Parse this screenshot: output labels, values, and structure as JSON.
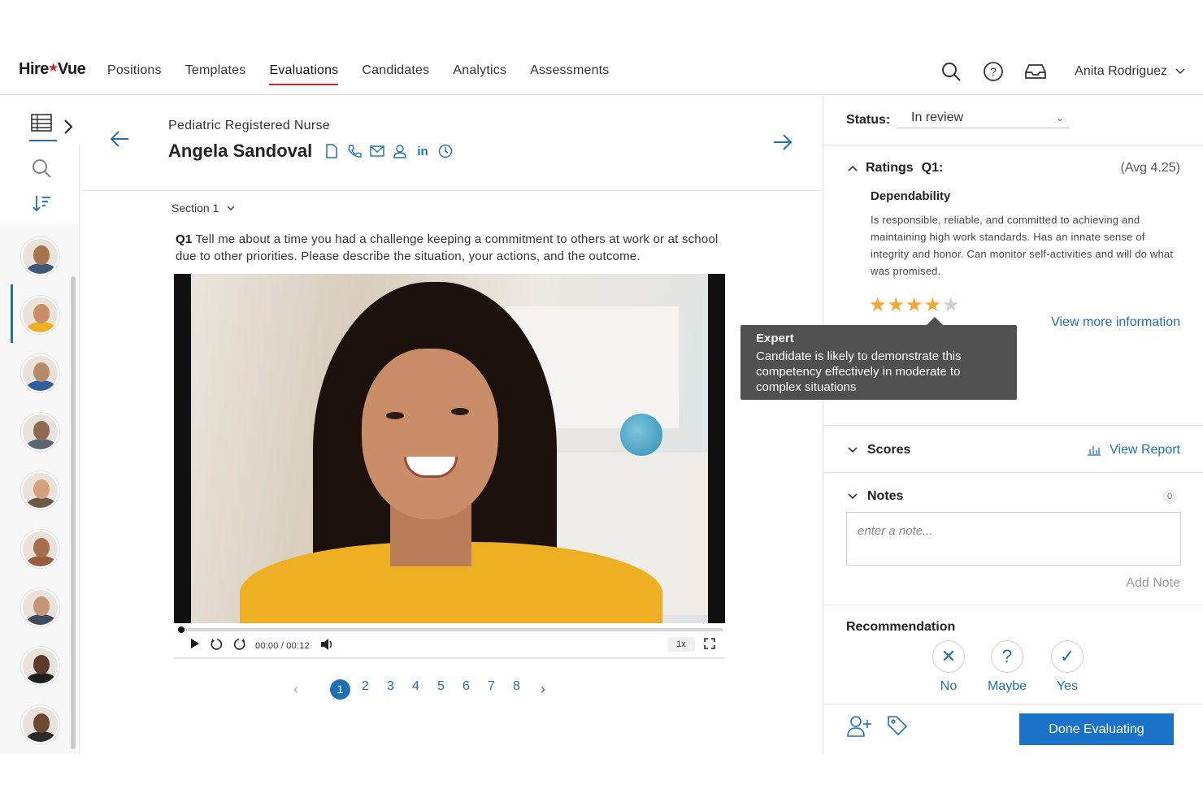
{
  "nav": {
    "logo_part1": "Hire",
    "logo_star": "★",
    "logo_part2": "Vue",
    "links": [
      "Positions",
      "Templates",
      "Evaluations",
      "Candidates",
      "Analytics",
      "Assessments"
    ],
    "active": "Evaluations",
    "user_name": "Anita Rodriguez",
    "icons": [
      "search-icon",
      "help-icon",
      "inbox-icon",
      "chevron-down-icon"
    ]
  },
  "rail": {
    "icons": [
      "grid-view-icon",
      "chevron-right-icon",
      "search-icon",
      "sort-icon"
    ],
    "avatars": [
      {
        "skin": "#a8734f",
        "shirt": "#3c5a7a"
      },
      {
        "skin": "#c98e68",
        "shirt": "#efaf23"
      },
      {
        "skin": "#b88a6a",
        "shirt": "#2f5f9e"
      },
      {
        "skin": "#8e6a52",
        "shirt": "#596673"
      },
      {
        "skin": "#d6a07d",
        "shirt": "#6b5a44"
      },
      {
        "skin": "#a66e4c",
        "shirt": "#9c5a3d"
      },
      {
        "skin": "#c79574",
        "shirt": "#3d4b5a"
      },
      {
        "skin": "#5a3b2a",
        "shirt": "#1e1e1e"
      },
      {
        "skin": "#6e4734",
        "shirt": "#2b2b2b"
      }
    ],
    "selected_index": 1
  },
  "candidate": {
    "position": "Pediatric Registered Nurse",
    "name": "Angela Sandoval",
    "linkedin": "in",
    "icons": [
      "document-icon",
      "phone-icon",
      "email-icon",
      "profile-icon",
      "linkedin-icon",
      "history-icon"
    ]
  },
  "section": {
    "label": "Section 1"
  },
  "question": {
    "number": "Q1",
    "text": "Tell me about a time you had a challenge keeping a commitment to others at work or at school due to other priorities. Please describe the situation, your actions, and the outcome."
  },
  "video": {
    "time": "00:00 / 00:12",
    "speed": "1x",
    "progress": 0
  },
  "pager": {
    "pages": [
      "1",
      "2",
      "3",
      "4",
      "5",
      "6",
      "7",
      "8"
    ],
    "current": "1"
  },
  "status": {
    "label": "Status:",
    "value": "In review"
  },
  "ratings": {
    "label": "Ratings",
    "question": "Q1:",
    "avg": "(Avg 4.25)",
    "competency": "Dependability",
    "description": "Is responsible, reliable, and committed to achieving and maintaining high work standards. Has an innate sense of integrity and honor. Can monitor self-activities and will do what was promised.",
    "stars": 4,
    "max_stars": 5,
    "star_on_color": "#f2a72e",
    "view_more": "View more information"
  },
  "tooltip": {
    "title": "Expert",
    "body": "Candidate is likely to demonstrate this competency effectively in moderate to complex situations"
  },
  "scores": {
    "label": "Scores",
    "view_report": "View Report"
  },
  "notes": {
    "label": "Notes",
    "count": "0",
    "placeholder": "enter a note...",
    "add": "Add Note"
  },
  "recommendation": {
    "label": "Recommendation",
    "options": [
      {
        "label": "No",
        "symbol": "✕"
      },
      {
        "label": "Maybe",
        "symbol": "?"
      },
      {
        "label": "Yes",
        "symbol": "✓"
      }
    ]
  },
  "footer": {
    "done": "Done Evaluating",
    "icons": [
      "add-user-icon",
      "tag-icon"
    ]
  },
  "colors": {
    "accent": "#1f6fb3",
    "brand_red": "#d6232c",
    "primary_button": "#1a73c9"
  }
}
